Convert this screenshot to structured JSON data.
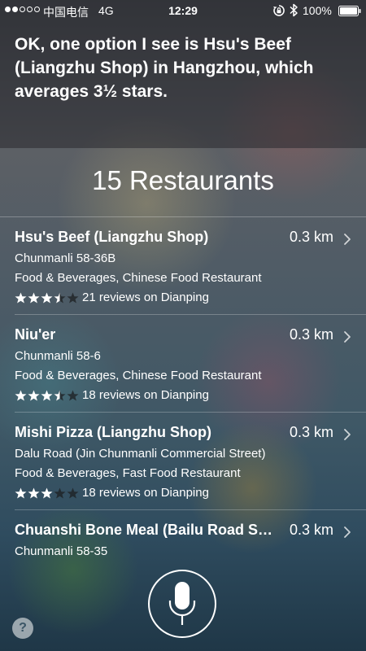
{
  "status_bar": {
    "carrier": "中国电信",
    "network": "4G",
    "time": "12:29",
    "battery": "100%",
    "signal_bars_filled": 2,
    "signal_bars_total": 5
  },
  "siri": {
    "response": "OK, one option I see is Hsu's Beef (Liangzhu Shop) in Hangzhou, which averages 3½ stars."
  },
  "results": {
    "title": "15 Restaurants",
    "items": [
      {
        "name": "Hsu's Beef (Liangzhu Shop)",
        "distance": "0.3 km",
        "address": "Chunmanli 58-36B",
        "category": "Food & Beverages, Chinese Food Restaurant",
        "rating": 3.5,
        "reviews": "21 reviews on Dianping"
      },
      {
        "name": "Niu'er",
        "distance": "0.3 km",
        "address": "Chunmanli 58-6",
        "category": "Food & Beverages, Chinese Food Restaurant",
        "rating": 3.5,
        "reviews": "18 reviews on Dianping"
      },
      {
        "name": "Mishi Pizza (Liangzhu Shop)",
        "distance": "0.3 km",
        "address": "Dalu Road (Jin Chunmanli Commercial Street)",
        "category": "Food & Beverages, Fast Food Restaurant",
        "rating": 3,
        "reviews": "18 reviews on Dianping"
      },
      {
        "name": "Chuanshi Bone Meal (Bailu Road Shop)",
        "distance": "0.3 km",
        "address": "Chunmanli 58-35"
      }
    ]
  },
  "controls": {
    "help_label": "?",
    "mic_icon": "microphone-icon"
  }
}
